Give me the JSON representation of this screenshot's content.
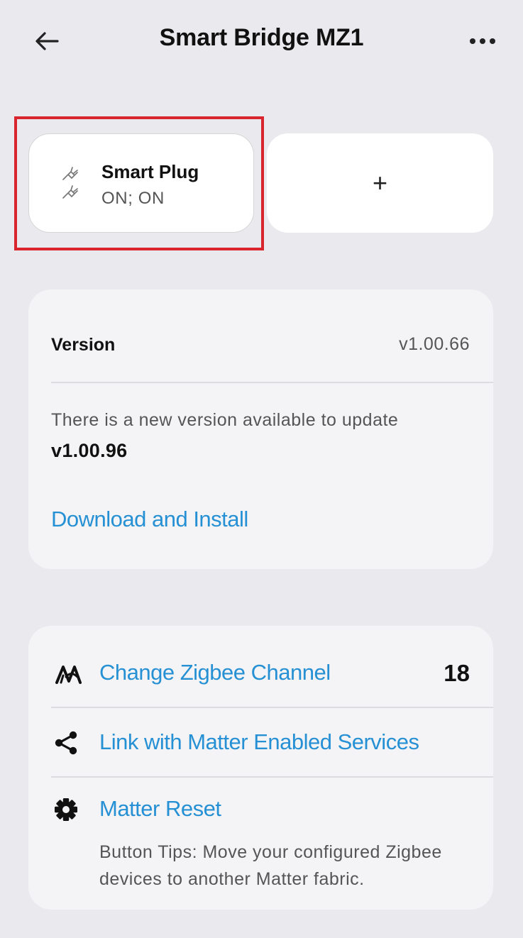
{
  "header": {
    "title": "Smart Bridge MZ1",
    "back_icon": "arrow-left-icon",
    "more_icon": "more-horizontal-icon"
  },
  "devices": {
    "items": [
      {
        "name": "Smart Plug",
        "status": "ON; ON",
        "icon": "plug-icon",
        "highlighted": true
      }
    ],
    "add_label": "+"
  },
  "version": {
    "label": "Version",
    "current": "v1.00.66",
    "update_message": "There is a new version available to update",
    "new_version": "v1.00.96",
    "action_label": "Download and Install"
  },
  "settings": {
    "zigbee_channel": {
      "label": "Change Zigbee Channel",
      "value": "18",
      "icon": "zigbee-icon"
    },
    "matter_link": {
      "label": "Link with Matter Enabled Services",
      "icon": "share-icon"
    },
    "matter_reset": {
      "label": "Matter Reset",
      "icon": "gear-icon",
      "tips": "Button Tips: Move your configured Zigbee devices to another Matter fabric."
    }
  },
  "colors": {
    "background": "#e9e9ee",
    "card": "#f4f4f6",
    "link": "#2690d4",
    "highlight_border": "#d9262e"
  }
}
